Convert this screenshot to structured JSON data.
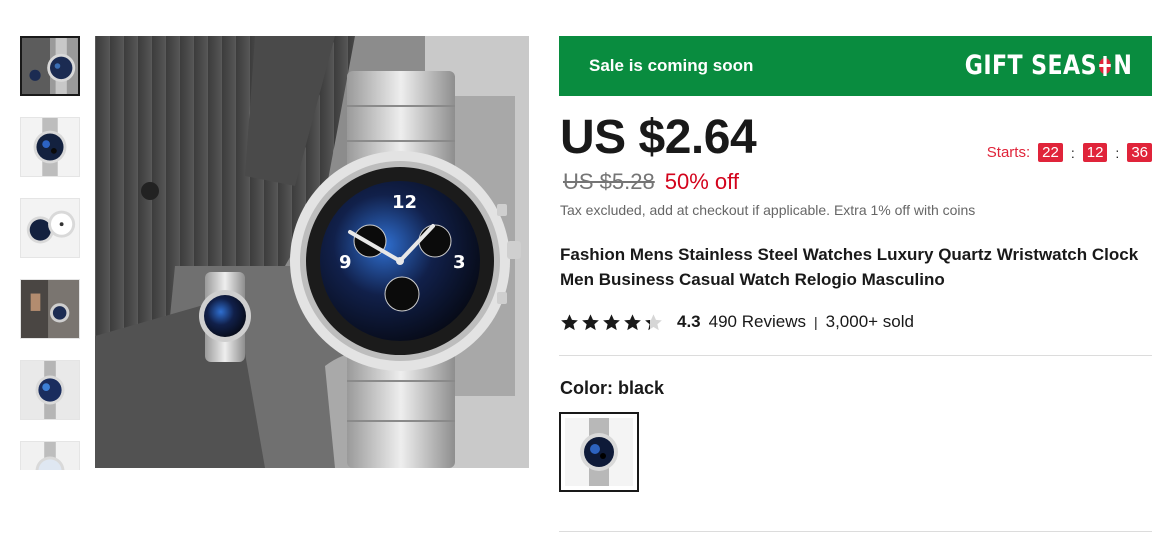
{
  "gallery": {
    "thumbnail_count": 6,
    "selected_index": 0,
    "main_image_icon": "watch-on-wrist-photo"
  },
  "banner": {
    "text": "Sale is coming soon",
    "brand": "GIFT SEASON",
    "brand_before_o": "GIFT SEAS",
    "brand_after_o": "N",
    "background": "#098c3f"
  },
  "price": {
    "current": "US $2.64",
    "original": "US $5.28",
    "discount": "50% off",
    "discount_color": "#d3031c"
  },
  "countdown": {
    "label": "Starts:",
    "hours": "22",
    "minutes": "12",
    "seconds": "36",
    "separator": ":",
    "color": "#e0243a"
  },
  "tax_note": "Tax excluded, add at checkout if applicable. Extra 1% off with coins",
  "product": {
    "title": "Fashion Mens Stainless Steel Watches Luxury Quartz Wristwatch Clock Men Business Casual Watch Relogio Masculino"
  },
  "rating": {
    "score": "4.3",
    "score_value": 4.3,
    "max": 5,
    "reviews": "490 Reviews",
    "separator": "|",
    "sold": "3,000+ sold"
  },
  "color_option": {
    "label": "Color: black",
    "selected_swatch": "black"
  }
}
